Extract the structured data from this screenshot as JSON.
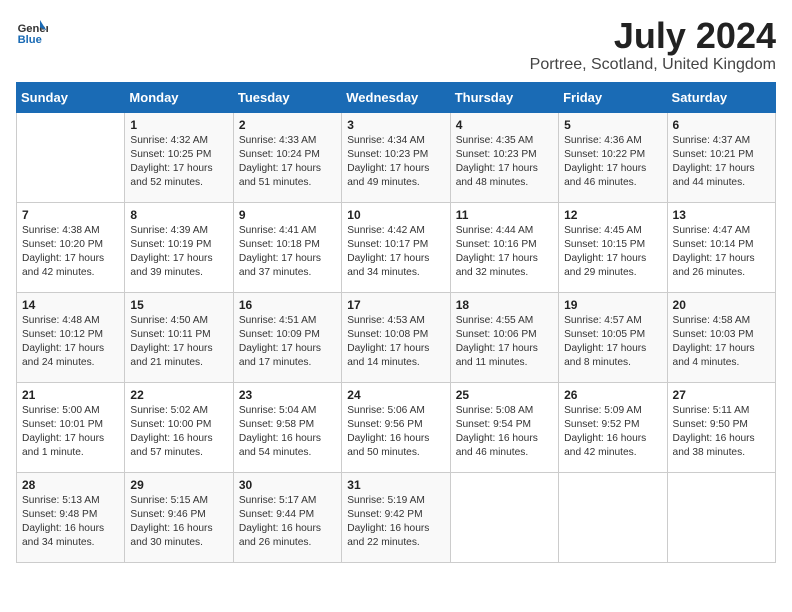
{
  "logo": {
    "general": "General",
    "blue": "Blue"
  },
  "title": "July 2024",
  "location": "Portree, Scotland, United Kingdom",
  "weekdays": [
    "Sunday",
    "Monday",
    "Tuesday",
    "Wednesday",
    "Thursday",
    "Friday",
    "Saturday"
  ],
  "weeks": [
    [
      {
        "day": "",
        "info": ""
      },
      {
        "day": "1",
        "info": "Sunrise: 4:32 AM\nSunset: 10:25 PM\nDaylight: 17 hours\nand 52 minutes."
      },
      {
        "day": "2",
        "info": "Sunrise: 4:33 AM\nSunset: 10:24 PM\nDaylight: 17 hours\nand 51 minutes."
      },
      {
        "day": "3",
        "info": "Sunrise: 4:34 AM\nSunset: 10:23 PM\nDaylight: 17 hours\nand 49 minutes."
      },
      {
        "day": "4",
        "info": "Sunrise: 4:35 AM\nSunset: 10:23 PM\nDaylight: 17 hours\nand 48 minutes."
      },
      {
        "day": "5",
        "info": "Sunrise: 4:36 AM\nSunset: 10:22 PM\nDaylight: 17 hours\nand 46 minutes."
      },
      {
        "day": "6",
        "info": "Sunrise: 4:37 AM\nSunset: 10:21 PM\nDaylight: 17 hours\nand 44 minutes."
      }
    ],
    [
      {
        "day": "7",
        "info": "Sunrise: 4:38 AM\nSunset: 10:20 PM\nDaylight: 17 hours\nand 42 minutes."
      },
      {
        "day": "8",
        "info": "Sunrise: 4:39 AM\nSunset: 10:19 PM\nDaylight: 17 hours\nand 39 minutes."
      },
      {
        "day": "9",
        "info": "Sunrise: 4:41 AM\nSunset: 10:18 PM\nDaylight: 17 hours\nand 37 minutes."
      },
      {
        "day": "10",
        "info": "Sunrise: 4:42 AM\nSunset: 10:17 PM\nDaylight: 17 hours\nand 34 minutes."
      },
      {
        "day": "11",
        "info": "Sunrise: 4:44 AM\nSunset: 10:16 PM\nDaylight: 17 hours\nand 32 minutes."
      },
      {
        "day": "12",
        "info": "Sunrise: 4:45 AM\nSunset: 10:15 PM\nDaylight: 17 hours\nand 29 minutes."
      },
      {
        "day": "13",
        "info": "Sunrise: 4:47 AM\nSunset: 10:14 PM\nDaylight: 17 hours\nand 26 minutes."
      }
    ],
    [
      {
        "day": "14",
        "info": "Sunrise: 4:48 AM\nSunset: 10:12 PM\nDaylight: 17 hours\nand 24 minutes."
      },
      {
        "day": "15",
        "info": "Sunrise: 4:50 AM\nSunset: 10:11 PM\nDaylight: 17 hours\nand 21 minutes."
      },
      {
        "day": "16",
        "info": "Sunrise: 4:51 AM\nSunset: 10:09 PM\nDaylight: 17 hours\nand 17 minutes."
      },
      {
        "day": "17",
        "info": "Sunrise: 4:53 AM\nSunset: 10:08 PM\nDaylight: 17 hours\nand 14 minutes."
      },
      {
        "day": "18",
        "info": "Sunrise: 4:55 AM\nSunset: 10:06 PM\nDaylight: 17 hours\nand 11 minutes."
      },
      {
        "day": "19",
        "info": "Sunrise: 4:57 AM\nSunset: 10:05 PM\nDaylight: 17 hours\nand 8 minutes."
      },
      {
        "day": "20",
        "info": "Sunrise: 4:58 AM\nSunset: 10:03 PM\nDaylight: 17 hours\nand 4 minutes."
      }
    ],
    [
      {
        "day": "21",
        "info": "Sunrise: 5:00 AM\nSunset: 10:01 PM\nDaylight: 17 hours\nand 1 minute."
      },
      {
        "day": "22",
        "info": "Sunrise: 5:02 AM\nSunset: 10:00 PM\nDaylight: 16 hours\nand 57 minutes."
      },
      {
        "day": "23",
        "info": "Sunrise: 5:04 AM\nSunset: 9:58 PM\nDaylight: 16 hours\nand 54 minutes."
      },
      {
        "day": "24",
        "info": "Sunrise: 5:06 AM\nSunset: 9:56 PM\nDaylight: 16 hours\nand 50 minutes."
      },
      {
        "day": "25",
        "info": "Sunrise: 5:08 AM\nSunset: 9:54 PM\nDaylight: 16 hours\nand 46 minutes."
      },
      {
        "day": "26",
        "info": "Sunrise: 5:09 AM\nSunset: 9:52 PM\nDaylight: 16 hours\nand 42 minutes."
      },
      {
        "day": "27",
        "info": "Sunrise: 5:11 AM\nSunset: 9:50 PM\nDaylight: 16 hours\nand 38 minutes."
      }
    ],
    [
      {
        "day": "28",
        "info": "Sunrise: 5:13 AM\nSunset: 9:48 PM\nDaylight: 16 hours\nand 34 minutes."
      },
      {
        "day": "29",
        "info": "Sunrise: 5:15 AM\nSunset: 9:46 PM\nDaylight: 16 hours\nand 30 minutes."
      },
      {
        "day": "30",
        "info": "Sunrise: 5:17 AM\nSunset: 9:44 PM\nDaylight: 16 hours\nand 26 minutes."
      },
      {
        "day": "31",
        "info": "Sunrise: 5:19 AM\nSunset: 9:42 PM\nDaylight: 16 hours\nand 22 minutes."
      },
      {
        "day": "",
        "info": ""
      },
      {
        "day": "",
        "info": ""
      },
      {
        "day": "",
        "info": ""
      }
    ]
  ]
}
